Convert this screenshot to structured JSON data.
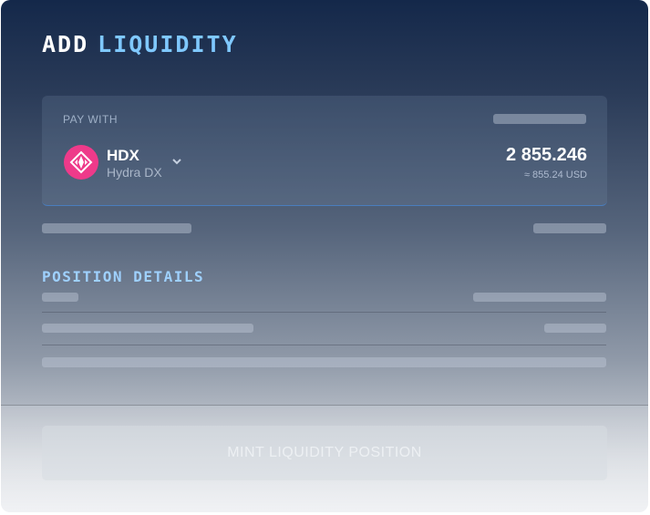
{
  "title": {
    "word1": "ADD",
    "word2": "LIQUIDITY"
  },
  "pay_with": {
    "label": "PAY WITH",
    "token": {
      "symbol": "HDX",
      "name": "Hydra DX",
      "icon": "hydradx-logo"
    },
    "amount": "2 855.246",
    "usd_value": "≈ 855.24 USD"
  },
  "position_details": {
    "title": "POSITION DETAILS"
  },
  "submit": {
    "label": "MINT LIQUIDITY POSITION"
  },
  "colors": {
    "accent": "#7fc8ff",
    "token": "#ee3a8a",
    "card_border": "#4a7dbd"
  }
}
